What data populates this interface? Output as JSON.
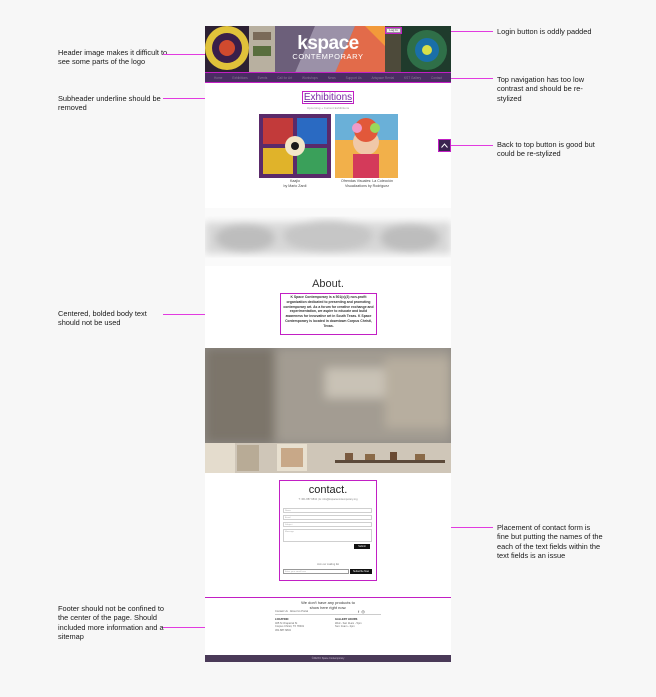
{
  "annotations": {
    "header": "Header image makes it difficult to see some parts of the logo",
    "login": "Login button is oddly padded",
    "nav": "Top navigation has too low contrast and should be re-stylized",
    "subheader": "Subheader underline should be removed",
    "totop": "Back to top button is good but could be re-stylized",
    "body_text": "Centered, bolded body text should not be used",
    "contact": "Placement of contact form is fine but putting the names of the each of the text fields within the text fields is an issue",
    "footer": "Footer should not be confined to the center of the page. Should included more information and a sitemap"
  },
  "site": {
    "logo_main": "kspace",
    "logo_sub": "CONTEMPORARY",
    "login_label": "Log In",
    "nav": [
      "Home",
      "Exhibitions",
      "Events",
      "Call for Art",
      "Workshops",
      "News",
      "Support Us",
      "Artspace Rental",
      "KST Gallery",
      "Contact"
    ],
    "exhibitions_title": "Exhibitions",
    "exhibitions_sub": "Upcoming + Current Exhibitions",
    "card1_caption_1": "Kaajio",
    "card1_caption_2": "by Mario Zardi",
    "card2_caption_1": "Ofrendas Visuales: La Colección",
    "card2_caption_2": "Visualizations by Rodriguez",
    "about_title": "About.",
    "about_body": "K Space Contemporary is a 501(c)(3) non-profit organization dedicated to presenting and promoting contemporary art. As a forum for creative exchange and experimentation, we aspire to educate and build awareness for innovative art in South Texas. K Space Contemporary is located in downtown Corpus Christi, Texas.",
    "contact_title": "contact.",
    "contact_info": "T: 361.887.6834  |  E: info@kspacecontemporary.org",
    "fields": [
      "Name",
      "Email",
      "Subject",
      "Message"
    ],
    "send_label": "Submit",
    "newsletter_label": "Join our mailing list",
    "newsletter_placeholder": "Enter your email here",
    "newsletter_btn": "Subscribe Now",
    "footer_tagline_1": "We don't have any products to",
    "footer_tagline_2": "show here right now.",
    "footer_link_1": "Contact Us",
    "footer_link_2": "About Us Portal",
    "loc_title": "LOCATION",
    "loc_1": "405 N Chaparral St",
    "loc_2": "Corpus Christi, TX 78401",
    "loc_3": "361.887.6834",
    "hours_title": "GALLERY HOURS",
    "hours_1": "Wed - Sat: 11am - 5pm",
    "hours_2": "Sun: 11am - 2pm",
    "copyright": "©2023 K Space Contemporary"
  },
  "colors": {
    "accent_annotation": "#e23be0",
    "nav_bg": "#4a2c63",
    "title_purple": "#7a2aa4"
  }
}
